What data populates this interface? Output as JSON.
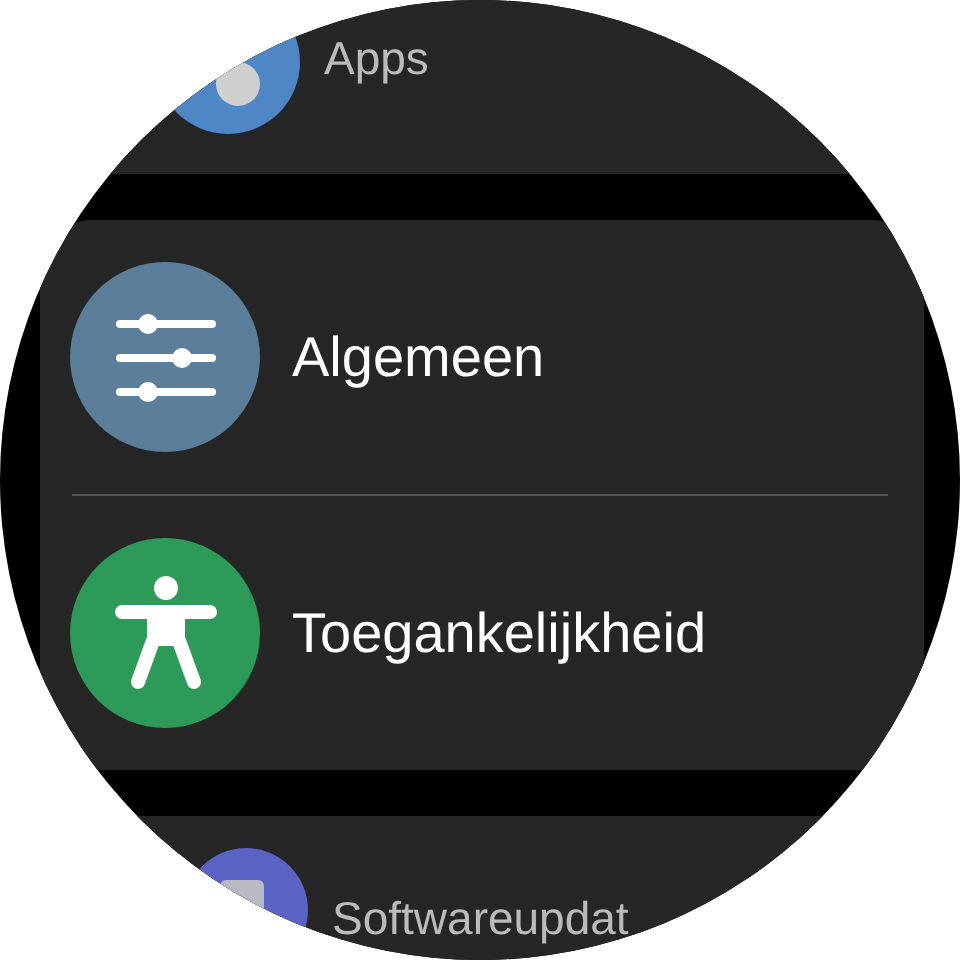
{
  "groups": [
    {
      "items": [
        {
          "label": "Apps",
          "color": "#4f86c6"
        }
      ]
    },
    {
      "items": [
        {
          "label": "Algemeen",
          "color": "#5b7f9b"
        },
        {
          "label": "Toegankelijkheid",
          "color": "#2e9a5a"
        }
      ]
    },
    {
      "items": [
        {
          "label": "Softwareupdat",
          "color": "#5b63c4"
        }
      ]
    }
  ]
}
